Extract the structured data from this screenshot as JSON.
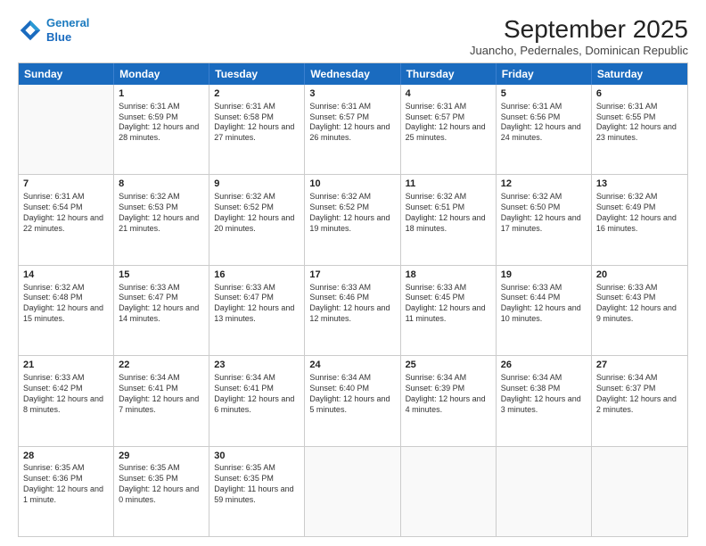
{
  "header": {
    "logo_line1": "General",
    "logo_line2": "Blue",
    "title": "September 2025",
    "subtitle": "Juancho, Pedernales, Dominican Republic"
  },
  "days": [
    "Sunday",
    "Monday",
    "Tuesday",
    "Wednesday",
    "Thursday",
    "Friday",
    "Saturday"
  ],
  "weeks": [
    [
      {
        "num": "",
        "sunrise": "",
        "sunset": "",
        "daylight": ""
      },
      {
        "num": "1",
        "sunrise": "Sunrise: 6:31 AM",
        "sunset": "Sunset: 6:59 PM",
        "daylight": "Daylight: 12 hours and 28 minutes."
      },
      {
        "num": "2",
        "sunrise": "Sunrise: 6:31 AM",
        "sunset": "Sunset: 6:58 PM",
        "daylight": "Daylight: 12 hours and 27 minutes."
      },
      {
        "num": "3",
        "sunrise": "Sunrise: 6:31 AM",
        "sunset": "Sunset: 6:57 PM",
        "daylight": "Daylight: 12 hours and 26 minutes."
      },
      {
        "num": "4",
        "sunrise": "Sunrise: 6:31 AM",
        "sunset": "Sunset: 6:57 PM",
        "daylight": "Daylight: 12 hours and 25 minutes."
      },
      {
        "num": "5",
        "sunrise": "Sunrise: 6:31 AM",
        "sunset": "Sunset: 6:56 PM",
        "daylight": "Daylight: 12 hours and 24 minutes."
      },
      {
        "num": "6",
        "sunrise": "Sunrise: 6:31 AM",
        "sunset": "Sunset: 6:55 PM",
        "daylight": "Daylight: 12 hours and 23 minutes."
      }
    ],
    [
      {
        "num": "7",
        "sunrise": "Sunrise: 6:31 AM",
        "sunset": "Sunset: 6:54 PM",
        "daylight": "Daylight: 12 hours and 22 minutes."
      },
      {
        "num": "8",
        "sunrise": "Sunrise: 6:32 AM",
        "sunset": "Sunset: 6:53 PM",
        "daylight": "Daylight: 12 hours and 21 minutes."
      },
      {
        "num": "9",
        "sunrise": "Sunrise: 6:32 AM",
        "sunset": "Sunset: 6:52 PM",
        "daylight": "Daylight: 12 hours and 20 minutes."
      },
      {
        "num": "10",
        "sunrise": "Sunrise: 6:32 AM",
        "sunset": "Sunset: 6:52 PM",
        "daylight": "Daylight: 12 hours and 19 minutes."
      },
      {
        "num": "11",
        "sunrise": "Sunrise: 6:32 AM",
        "sunset": "Sunset: 6:51 PM",
        "daylight": "Daylight: 12 hours and 18 minutes."
      },
      {
        "num": "12",
        "sunrise": "Sunrise: 6:32 AM",
        "sunset": "Sunset: 6:50 PM",
        "daylight": "Daylight: 12 hours and 17 minutes."
      },
      {
        "num": "13",
        "sunrise": "Sunrise: 6:32 AM",
        "sunset": "Sunset: 6:49 PM",
        "daylight": "Daylight: 12 hours and 16 minutes."
      }
    ],
    [
      {
        "num": "14",
        "sunrise": "Sunrise: 6:32 AM",
        "sunset": "Sunset: 6:48 PM",
        "daylight": "Daylight: 12 hours and 15 minutes."
      },
      {
        "num": "15",
        "sunrise": "Sunrise: 6:33 AM",
        "sunset": "Sunset: 6:47 PM",
        "daylight": "Daylight: 12 hours and 14 minutes."
      },
      {
        "num": "16",
        "sunrise": "Sunrise: 6:33 AM",
        "sunset": "Sunset: 6:47 PM",
        "daylight": "Daylight: 12 hours and 13 minutes."
      },
      {
        "num": "17",
        "sunrise": "Sunrise: 6:33 AM",
        "sunset": "Sunset: 6:46 PM",
        "daylight": "Daylight: 12 hours and 12 minutes."
      },
      {
        "num": "18",
        "sunrise": "Sunrise: 6:33 AM",
        "sunset": "Sunset: 6:45 PM",
        "daylight": "Daylight: 12 hours and 11 minutes."
      },
      {
        "num": "19",
        "sunrise": "Sunrise: 6:33 AM",
        "sunset": "Sunset: 6:44 PM",
        "daylight": "Daylight: 12 hours and 10 minutes."
      },
      {
        "num": "20",
        "sunrise": "Sunrise: 6:33 AM",
        "sunset": "Sunset: 6:43 PM",
        "daylight": "Daylight: 12 hours and 9 minutes."
      }
    ],
    [
      {
        "num": "21",
        "sunrise": "Sunrise: 6:33 AM",
        "sunset": "Sunset: 6:42 PM",
        "daylight": "Daylight: 12 hours and 8 minutes."
      },
      {
        "num": "22",
        "sunrise": "Sunrise: 6:34 AM",
        "sunset": "Sunset: 6:41 PM",
        "daylight": "Daylight: 12 hours and 7 minutes."
      },
      {
        "num": "23",
        "sunrise": "Sunrise: 6:34 AM",
        "sunset": "Sunset: 6:41 PM",
        "daylight": "Daylight: 12 hours and 6 minutes."
      },
      {
        "num": "24",
        "sunrise": "Sunrise: 6:34 AM",
        "sunset": "Sunset: 6:40 PM",
        "daylight": "Daylight: 12 hours and 5 minutes."
      },
      {
        "num": "25",
        "sunrise": "Sunrise: 6:34 AM",
        "sunset": "Sunset: 6:39 PM",
        "daylight": "Daylight: 12 hours and 4 minutes."
      },
      {
        "num": "26",
        "sunrise": "Sunrise: 6:34 AM",
        "sunset": "Sunset: 6:38 PM",
        "daylight": "Daylight: 12 hours and 3 minutes."
      },
      {
        "num": "27",
        "sunrise": "Sunrise: 6:34 AM",
        "sunset": "Sunset: 6:37 PM",
        "daylight": "Daylight: 12 hours and 2 minutes."
      }
    ],
    [
      {
        "num": "28",
        "sunrise": "Sunrise: 6:35 AM",
        "sunset": "Sunset: 6:36 PM",
        "daylight": "Daylight: 12 hours and 1 minute."
      },
      {
        "num": "29",
        "sunrise": "Sunrise: 6:35 AM",
        "sunset": "Sunset: 6:35 PM",
        "daylight": "Daylight: 12 hours and 0 minutes."
      },
      {
        "num": "30",
        "sunrise": "Sunrise: 6:35 AM",
        "sunset": "Sunset: 6:35 PM",
        "daylight": "Daylight: 11 hours and 59 minutes."
      },
      {
        "num": "",
        "sunrise": "",
        "sunset": "",
        "daylight": ""
      },
      {
        "num": "",
        "sunrise": "",
        "sunset": "",
        "daylight": ""
      },
      {
        "num": "",
        "sunrise": "",
        "sunset": "",
        "daylight": ""
      },
      {
        "num": "",
        "sunrise": "",
        "sunset": "",
        "daylight": ""
      }
    ]
  ]
}
